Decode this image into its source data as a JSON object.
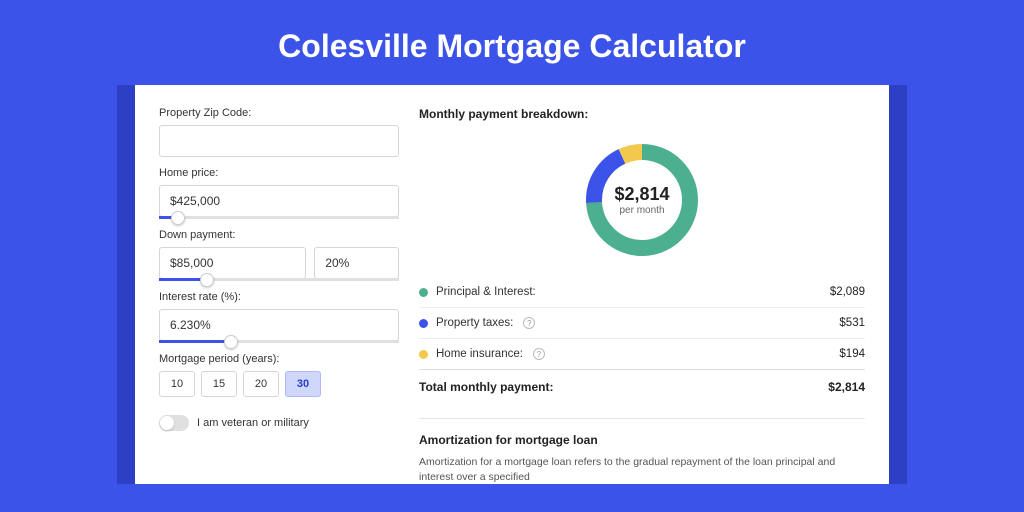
{
  "title": "Colesville Mortgage Calculator",
  "fields": {
    "zip_label": "Property Zip Code:",
    "zip_value": "",
    "home_price_label": "Home price:",
    "home_price_value": "$425,000",
    "home_price_slider_pct": 8,
    "down_payment_label": "Down payment:",
    "down_payment_value": "$85,000",
    "down_payment_pct": "20%",
    "down_payment_slider_pct": 20,
    "interest_label": "Interest rate (%):",
    "interest_value": "6.230%",
    "interest_slider_pct": 30,
    "period_label": "Mortgage period (years):",
    "period_options": [
      "10",
      "15",
      "20",
      "30"
    ],
    "period_selected": "30",
    "veteran_label": "I am veteran or military",
    "veteran_on": false
  },
  "breakdown": {
    "title": "Monthly payment breakdown:",
    "center_amount": "$2,814",
    "center_sub": "per month",
    "items": [
      {
        "label": "Principal & Interest:",
        "value": "$2,089",
        "color": "#4caf8f",
        "info": false,
        "pct": 74
      },
      {
        "label": "Property taxes:",
        "value": "$531",
        "color": "#3b53e8",
        "info": true,
        "pct": 19
      },
      {
        "label": "Home insurance:",
        "value": "$194",
        "color": "#f2c94c",
        "info": true,
        "pct": 7
      }
    ],
    "total_label": "Total monthly payment:",
    "total_value": "$2,814"
  },
  "amortization": {
    "title": "Amortization for mortgage loan",
    "text": "Amortization for a mortgage loan refers to the gradual repayment of the loan principal and interest over a specified"
  },
  "chart_data": {
    "type": "pie",
    "title": "Monthly payment breakdown",
    "series": [
      {
        "name": "Principal & Interest",
        "value": 2089,
        "color": "#4caf8f"
      },
      {
        "name": "Property taxes",
        "value": 531,
        "color": "#3b53e8"
      },
      {
        "name": "Home insurance",
        "value": 194,
        "color": "#f2c94c"
      }
    ],
    "total": 2814,
    "unit": "USD per month"
  }
}
